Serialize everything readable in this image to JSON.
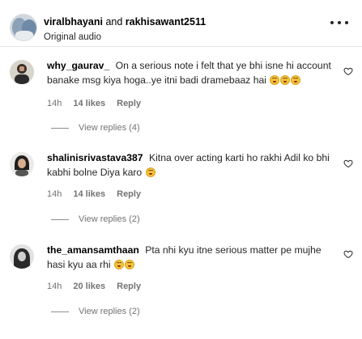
{
  "header": {
    "user1": "viralbhayani",
    "joiner": "and",
    "user2": "rakhisawant2511",
    "subtitle": "Original audio"
  },
  "comments": [
    {
      "username": "why_gaurav_",
      "text": "On a serious note i felt that ye bhi isne hi account banake msg kiya hoga..ye itni badi dramebaaz hai",
      "emoji_count": 3,
      "time": "14h",
      "likes": "14 likes",
      "reply": "Reply",
      "view_replies": "View replies (4)"
    },
    {
      "username": "shalinisrivastava387",
      "text": "Kitna over acting karti ho rakhi Adil ko bhi kabhi bolne Diya karo",
      "emoji_count": 1,
      "time": "14h",
      "likes": "14 likes",
      "reply": "Reply",
      "view_replies": "View replies (2)"
    },
    {
      "username": "the_amansamthaan",
      "text": "Pta nhi kyu itne serious matter pe mujhe hasi kyu aa rhi",
      "emoji_count": 2,
      "time": "14h",
      "likes": "20 likes",
      "reply": "Reply",
      "view_replies": "View replies (2)"
    }
  ],
  "icons": {
    "more": "more-options-icon",
    "like": "heart-icon",
    "emoji": "face-with-tears-of-joy-icon"
  },
  "colors": {
    "secondary_text": "#737373",
    "emoji": "#f5c33b"
  }
}
